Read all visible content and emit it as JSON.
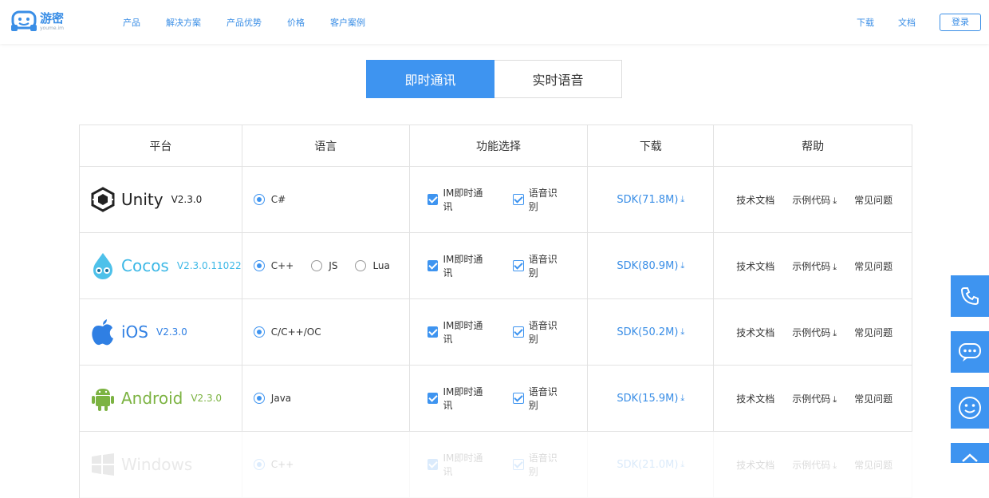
{
  "header": {
    "logo_cn": "游密",
    "logo_en": "youme.im",
    "nav": [
      "产品",
      "解决方案",
      "产品优势",
      "价格",
      "客户案例"
    ],
    "right_links": [
      "下载",
      "文档"
    ],
    "login": "登录"
  },
  "tabs": [
    "即时通讯",
    "实时语音"
  ],
  "table": {
    "headers": [
      "平台",
      "语言",
      "功能选择",
      "下载",
      "帮助"
    ],
    "help_links": [
      "技术文档",
      "示例代码",
      "常见问题"
    ],
    "features": [
      "IM即时通讯",
      "语音识别"
    ],
    "rows": [
      {
        "name": "Unity",
        "version": "V2.3.0",
        "color": "#222222",
        "icon": "unity-icon",
        "langs": [
          "C#"
        ],
        "sdk": "SDK(71.8M)"
      },
      {
        "name": "Cocos",
        "version": "V2.3.0.11022",
        "color": "#3cb8e6",
        "icon": "cocos-icon",
        "langs": [
          "C++",
          "JS",
          "Lua"
        ],
        "sdk": "SDK(80.9M)"
      },
      {
        "name": "iOS",
        "version": "V2.3.0",
        "color": "#2f7fe3",
        "icon": "apple-icon",
        "langs": [
          "C/C++/OC"
        ],
        "sdk": "SDK(50.2M)"
      },
      {
        "name": "Android",
        "version": "V2.3.0",
        "color": "#7cb342",
        "icon": "android-icon",
        "langs": [
          "Java"
        ],
        "sdk": "SDK(15.9M)"
      },
      {
        "name": "Windows",
        "version": "",
        "color": "#888888",
        "icon": "windows-icon",
        "langs": [
          "C++"
        ],
        "sdk": "SDK(21.0M)"
      }
    ]
  },
  "side_buttons": [
    "phone-icon",
    "chat-icon",
    "smile-icon",
    "up-arrow-icon"
  ],
  "colors": {
    "accent": "#3e94f0",
    "border": "#e2e2e2"
  }
}
